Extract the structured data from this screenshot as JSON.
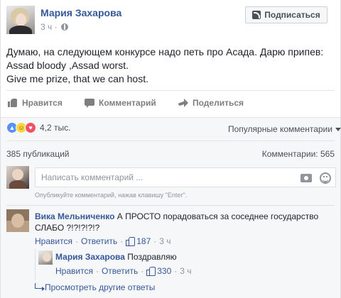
{
  "post": {
    "author": "Мария Захарова",
    "time": "3 ч",
    "subscribe_label": "Подписаться",
    "text_lines": [
      "Думаю, на следующем конкурсе надо петь про Асада. Дарю припев:",
      "Assad bloody ,Assad worst.",
      "Give me prize, that we can host."
    ]
  },
  "actions": {
    "like": "Нравится",
    "comment": "Комментарий",
    "share": "Поделиться"
  },
  "summary": {
    "reactions_count": "4,2 тыс.",
    "sort_label": "Популярные комментарии",
    "shares": "385 публикаций",
    "comments": "Комментарии: 565"
  },
  "composer": {
    "placeholder": "Написать комментарий ...",
    "hint": "Опубликуйте комментарий, нажав клавишу \"Enter\"."
  },
  "comments": [
    {
      "author": "Вика Мельниченко",
      "text": "А ПРОСТО порадоваться за соседнее государство СЛАБО ?!?!?!?!?",
      "like_label": "Нравится",
      "reply_label": "Ответить",
      "likes": "187",
      "time": "3 ч",
      "replies": [
        {
          "author": "Мария Захарова",
          "text": "Поздравляю",
          "like_label": "Нравится",
          "reply_label": "Ответить",
          "likes": "330",
          "time": "3 ч"
        }
      ]
    }
  ],
  "more_replies": "Просмотреть другие ответы",
  "icons": {
    "reactions": [
      "like-icon",
      "haha-icon",
      "love-icon"
    ],
    "privacy": "globe-icon"
  },
  "colors": {
    "link": "#365899",
    "muted": "#90949c",
    "like": "#5890ff",
    "love": "#f25268",
    "haha": "#fcd73f"
  }
}
